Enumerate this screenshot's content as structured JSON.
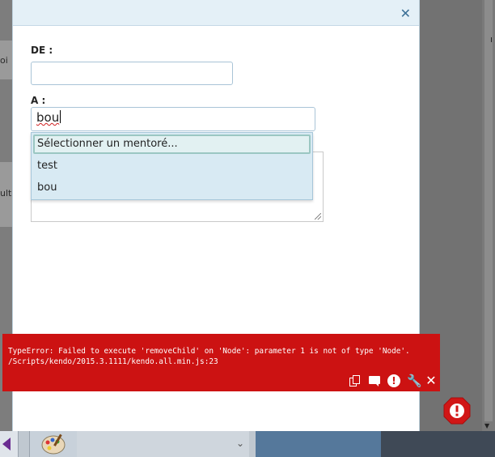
{
  "background_page": {
    "fragments": [
      "oi",
      "ult"
    ]
  },
  "form": {
    "from_label": "DE :",
    "from_value": "",
    "to_label": "A :",
    "to_value": "bou",
    "message_value": ""
  },
  "dropdown": {
    "items": [
      {
        "label": "Sélectionner un mentoré..."
      },
      {
        "label": "test"
      },
      {
        "label": "bou"
      }
    ]
  },
  "error": {
    "line1": "TypeError: Failed to execute 'removeChild' on 'Node': parameter 1 is not of type 'Node'.",
    "line2": "/Scripts/kendo/2015.3.1111/kendo.all.min.js:23"
  },
  "icons": {
    "close": "close-icon",
    "copy": "copy-icon",
    "comment": "comment-icon",
    "alert": "alert-icon",
    "wrench": "wrench-icon",
    "dismiss": "dismiss-icon"
  },
  "colors": {
    "error_red": "#cc1212",
    "header_blue": "#e4f0f7",
    "dropdown_bg": "#d8eaf3",
    "accent": "#3a6f96"
  }
}
